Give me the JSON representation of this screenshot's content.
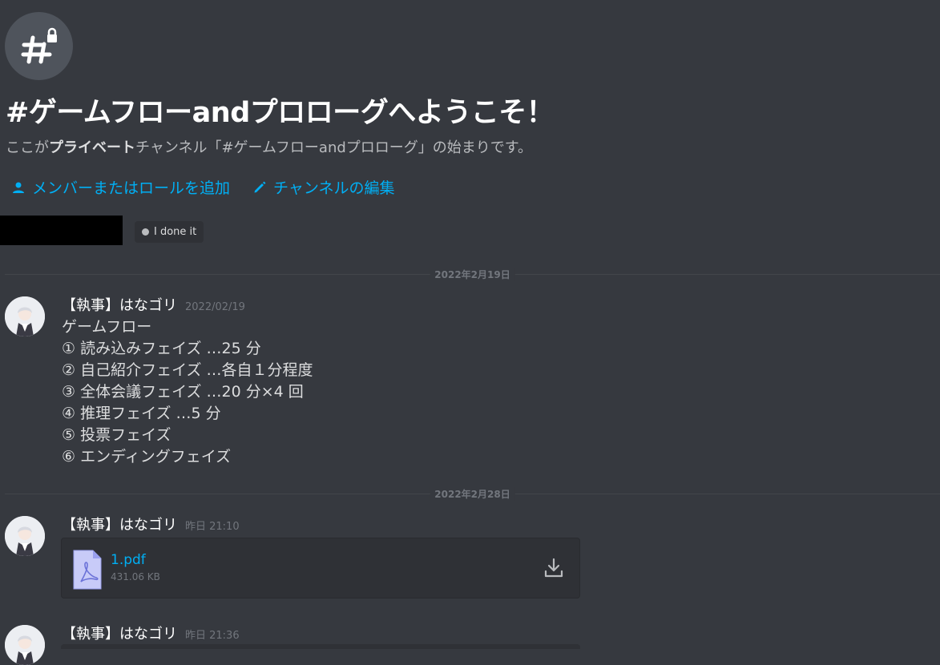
{
  "channel": {
    "icon": "private-channel-hash-lock-icon",
    "welcome_title": "#ゲームフローandプロローグへようこそ！",
    "desc_before": "ここが",
    "desc_bold": "プライベート",
    "desc_after": "チャンネル「#ゲームフローandプロローグ」の始まりです。",
    "actions": [
      {
        "label": "メンバーまたはロールを追加",
        "icon": "person-icon"
      },
      {
        "label": "チャンネルの編集",
        "icon": "pencil-icon"
      }
    ],
    "status_pill": "I done it"
  },
  "dividers": [
    "2022年2月19日",
    "2022年2月28日"
  ],
  "messages": [
    {
      "author": "【執事】はなゴリ",
      "timestamp": "2022/02/19",
      "lines": [
        "ゲームフロー",
        "① 読み込みフェイズ …25 分",
        "② 自己紹介フェイズ …各自１分程度",
        "③ 全体会議フェイズ …20 分×4 回",
        "④ 推理フェイズ …5 分",
        "⑤ 投票フェイズ",
        "⑥ エンディングフェイズ"
      ]
    },
    {
      "author": "【執事】はなゴリ",
      "timestamp": "昨日 21:10",
      "attachment": {
        "name": "1.pdf",
        "size": "431.06 KB",
        "icon": "pdf-file-icon",
        "action_icon": "download-icon"
      }
    },
    {
      "author": "【執事】はなゴリ",
      "timestamp": "昨日 21:36"
    }
  ],
  "colors": {
    "background": "#36393f",
    "link": "#00aff4",
    "muted": "#72767d",
    "text": "#dcddde"
  }
}
